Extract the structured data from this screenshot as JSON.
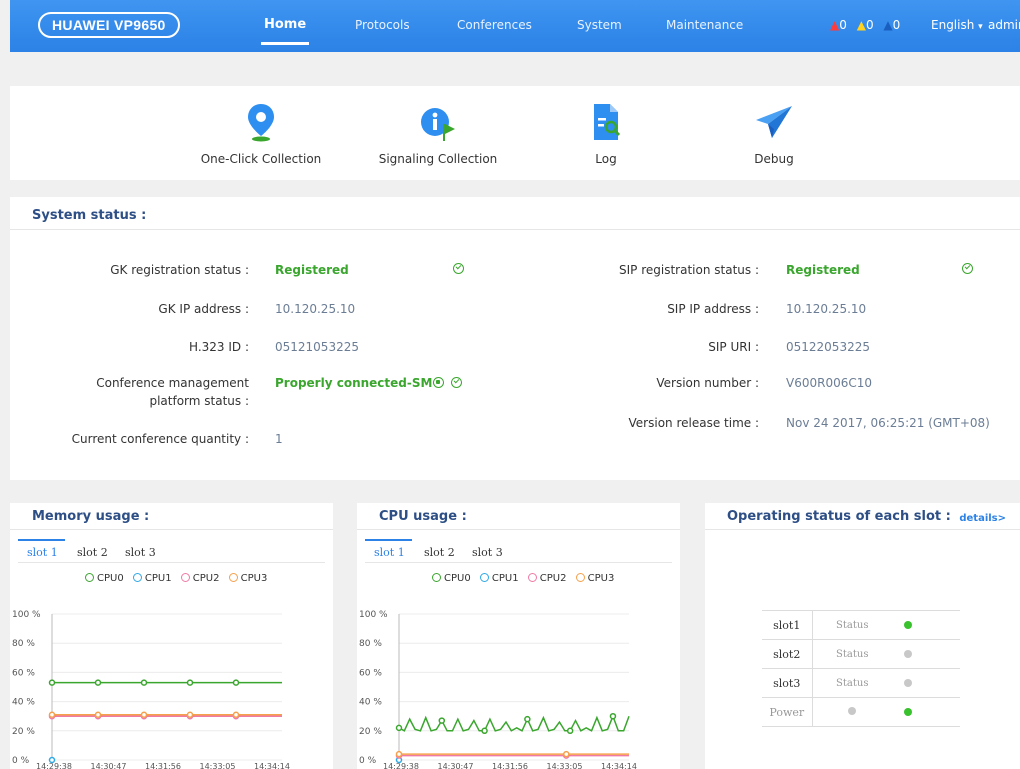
{
  "header": {
    "logo": "HUAWEI VP9650",
    "nav": [
      "Home",
      "Protocols",
      "Conferences",
      "System",
      "Maintenance"
    ],
    "alarms": [
      "0",
      "0",
      "0"
    ],
    "language": "English",
    "language_caret": "▾",
    "user": "admin"
  },
  "tools": [
    {
      "label": "One-Click Collection",
      "icon": "location-pin-icon"
    },
    {
      "label": "Signaling Collection",
      "icon": "info-flag-icon"
    },
    {
      "label": "Log",
      "icon": "log-search-icon"
    },
    {
      "label": "Debug",
      "icon": "paper-plane-icon"
    }
  ],
  "system_status": {
    "title": "System status :",
    "gk_status_label": "GK registration status :",
    "gk_status_value": "Registered",
    "gk_ip_label": "GK IP address :",
    "gk_ip_value": "10.120.25.10",
    "h323_label": "H.323 ID :",
    "h323_value": "05121053225",
    "conf_mgmt_label_1": "Conference management",
    "conf_mgmt_label_2": "platform status :",
    "conf_mgmt_value": "Properly connected-SMC",
    "conf_qty_label": "Current conference quantity :",
    "conf_qty_value": "1",
    "sip_status_label": "SIP registration status :",
    "sip_status_value": "Registered",
    "sip_ip_label": "SIP IP address :",
    "sip_ip_value": "10.120.25.10",
    "sip_uri_label": "SIP URI :",
    "sip_uri_value": "05122053225",
    "version_label": "Version number :",
    "version_value": "V600R006C10",
    "release_label": "Version release time :",
    "release_value": "Nov 24 2017, 06:25:21 (GMT+08)"
  },
  "memory": {
    "title": "Memory usage :",
    "tabs": [
      "slot 1",
      "slot 2",
      "slot 3"
    ],
    "legend": [
      "CPU0",
      "CPU1",
      "CPU2",
      "CPU3"
    ]
  },
  "cpu": {
    "title": "CPU usage :",
    "tabs": [
      "slot 1",
      "slot 2",
      "slot 3"
    ],
    "legend": [
      "CPU0",
      "CPU1",
      "CPU2",
      "CPU3"
    ]
  },
  "slots": {
    "title": "Operating status of each slot :",
    "details": "details>",
    "rows": [
      {
        "name": "slot1",
        "status": "Status",
        "state": "green"
      },
      {
        "name": "slot2",
        "status": "Status",
        "state": "grey"
      },
      {
        "name": "slot3",
        "status": "Status",
        "state": "grey"
      }
    ],
    "power_label": "Power",
    "power_states": [
      "grey",
      "green"
    ]
  },
  "colors": {
    "header_blue": "#2c82e6",
    "ok_green": "#3aa62e",
    "title_blue": "#2d4f86",
    "cpu0": "#3aa62e",
    "cpu1": "#2ea8e6",
    "cpu2": "#f07aa6",
    "cpu3": "#f5a04a"
  },
  "charts": {
    "memory": {
      "type": "line",
      "y_ticks": [
        "100 %",
        "80 %",
        "60 %",
        "40 %",
        "20 %",
        "0 %"
      ],
      "x_ticks": [
        "14:29:38",
        "14:30:47",
        "14:31:56",
        "14:33:05",
        "14:34:14"
      ],
      "ylim": [
        0,
        100
      ],
      "series": [
        {
          "name": "CPU0",
          "color": "#3aa62e",
          "values": [
            53,
            53,
            53,
            53,
            53,
            53
          ]
        },
        {
          "name": "CPU1",
          "color": "#2ea8e6",
          "values": [
            0
          ]
        },
        {
          "name": "CPU2",
          "color": "#f07aa6",
          "values": [
            30,
            30,
            30,
            30,
            30,
            30
          ]
        },
        {
          "name": "CPU3",
          "color": "#f5a04a",
          "values": [
            31,
            31,
            31,
            31,
            31,
            31
          ]
        }
      ]
    },
    "cpu": {
      "type": "line",
      "y_ticks": [
        "100 %",
        "80 %",
        "60 %",
        "40 %",
        "20 %",
        "0 %"
      ],
      "x_ticks": [
        "14:29:38",
        "14:30:47",
        "14:31:56",
        "14:33:05",
        "14:34:14"
      ],
      "ylim": [
        0,
        100
      ],
      "series": [
        {
          "name": "CPU0",
          "color": "#3aa62e",
          "values": [
            22,
            20,
            28,
            21,
            20,
            29,
            20,
            21,
            27,
            20,
            20,
            28,
            20,
            21,
            27,
            20,
            20,
            28,
            20,
            21,
            26,
            20,
            22,
            20,
            28,
            20,
            21,
            29,
            20,
            21,
            26,
            20,
            20,
            27,
            20,
            22,
            20,
            29,
            20,
            21,
            30,
            20,
            20,
            30
          ]
        },
        {
          "name": "CPU1",
          "color": "#2ea8e6",
          "values": [
            0
          ]
        },
        {
          "name": "CPU2",
          "color": "#f07aa6",
          "values": [
            3,
            3,
            3,
            3,
            3,
            3,
            3,
            3,
            3,
            3,
            3,
            3
          ]
        },
        {
          "name": "CPU3",
          "color": "#f5a04a",
          "values": [
            4,
            4,
            4,
            4,
            4,
            4,
            4,
            4,
            4,
            4,
            4,
            4
          ]
        }
      ]
    }
  }
}
